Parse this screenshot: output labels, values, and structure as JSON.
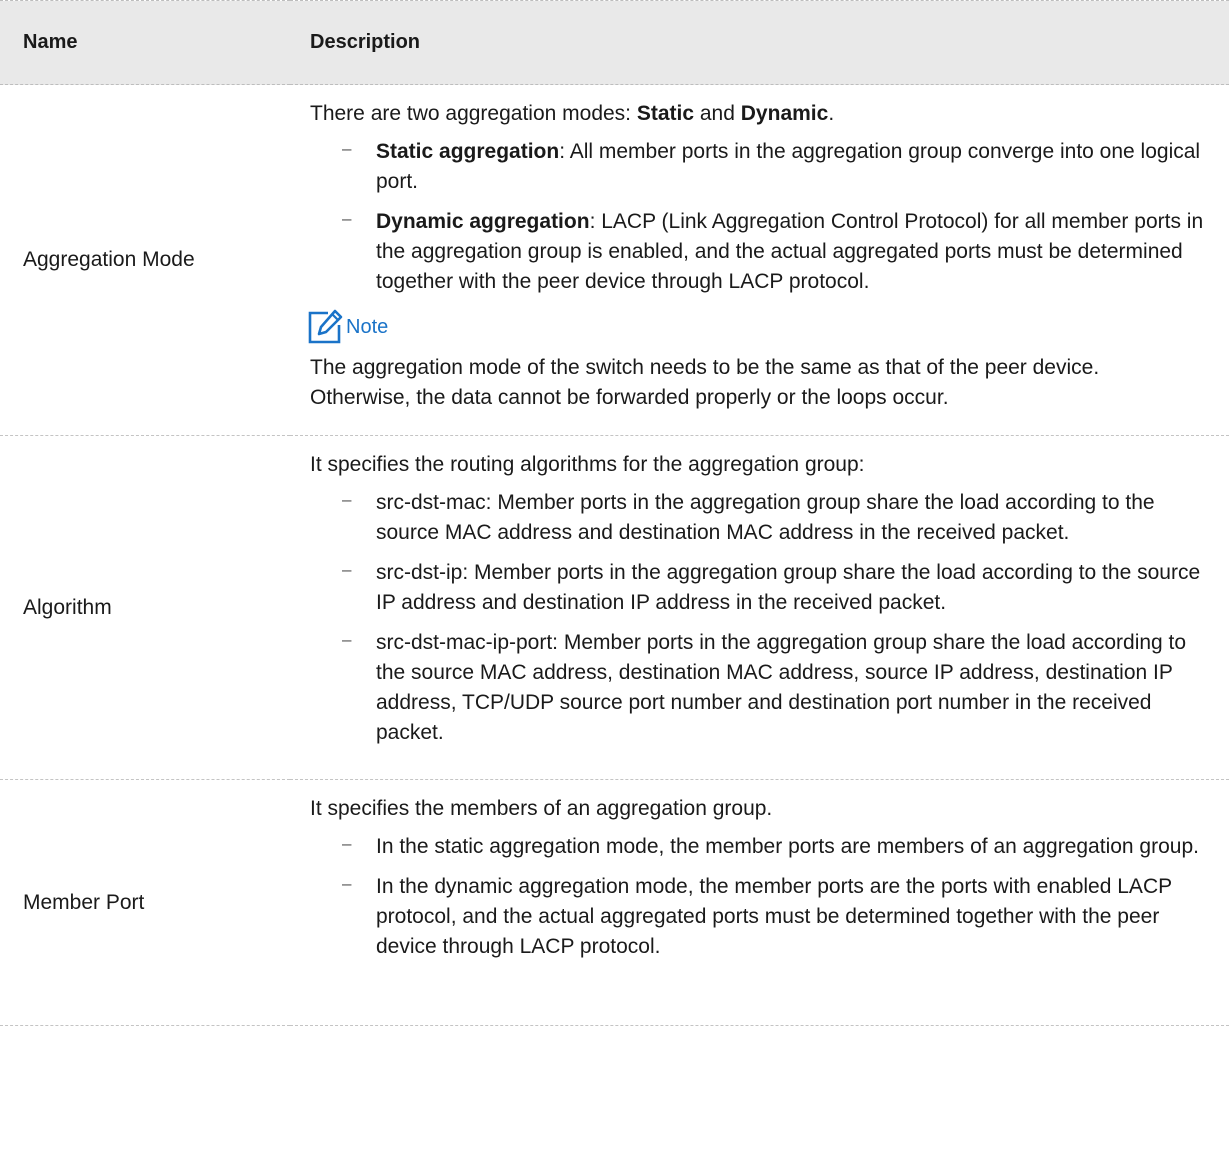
{
  "table": {
    "headers": {
      "name": "Name",
      "description": "Description"
    },
    "rows": [
      {
        "name": "Aggregation Mode",
        "intro": {
          "prefix": "There are two aggregation modes: ",
          "b1": "Static",
          "mid": " and ",
          "b2": "Dynamic",
          "suffix": "."
        },
        "bullets": [
          {
            "bold": "Static aggregation",
            "text": ": All member ports in the aggregation group converge into one logical port."
          },
          {
            "bold": "Dynamic aggregation",
            "text": ": LACP (Link Aggregation Control Protocol) for all member ports in the aggregation group is enabled, and the actual aggregated ports must be determined together with the peer device through LACP protocol."
          }
        ],
        "note": {
          "label": "Note",
          "text": "The aggregation mode of the switch needs to be the same as that of the peer device. Otherwise, the data cannot be forwarded properly or the loops occur."
        }
      },
      {
        "name": "Algorithm",
        "intro": "It specifies the routing algorithms for the aggregation group:",
        "bullets": [
          {
            "text": "src-dst-mac: Member ports in the aggregation group share the load according to the source MAC address and destination MAC address in the received packet."
          },
          {
            "text": "src-dst-ip: Member ports in the aggregation group share the load according to the source IP address and destination IP address in the received packet."
          },
          {
            "text": "src-dst-mac-ip-port: Member ports in the aggregation group share the load according to the source MAC address, destination MAC address, source IP address, destination IP address, TCP/UDP source port number and destination port number in the received packet."
          }
        ]
      },
      {
        "name": "Member Port",
        "intro": "It specifies the members of an aggregation group.",
        "bullets": [
          {
            "text": "In the static aggregation mode, the member ports are members of an aggregation group."
          },
          {
            "text": "In the dynamic aggregation mode, the member ports are the ports with enabled LACP protocol, and the actual aggregated ports must be determined together with the peer device through LACP protocol."
          }
        ]
      }
    ],
    "bullet_glyph": "–",
    "note_icon": "edit-note-icon",
    "accent_color": "#1a73c8"
  }
}
